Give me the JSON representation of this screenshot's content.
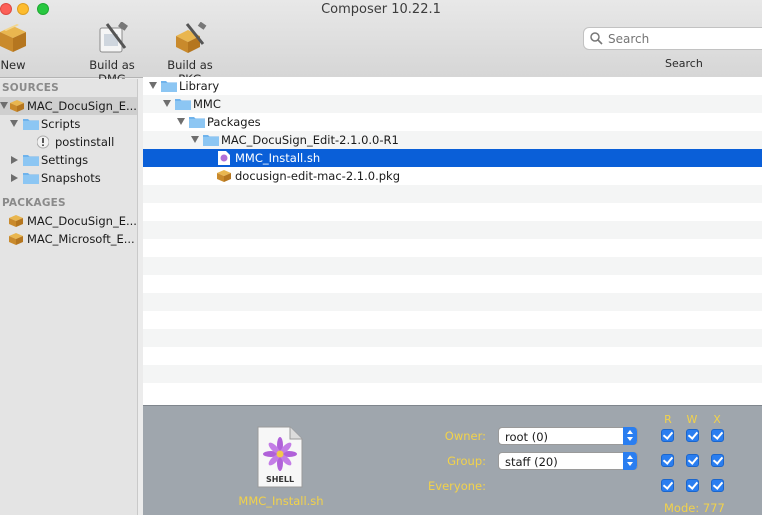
{
  "window": {
    "title": "Composer 10.22.1"
  },
  "toolbar": {
    "new_label": "New",
    "build_dmg_label": "Build as DMG",
    "build_pkg_label": "Build as PKG",
    "search_placeholder": "Search",
    "search_label": "Search"
  },
  "sidebar": {
    "sources_header": "SOURCES",
    "packages_header": "PACKAGES",
    "sources": [
      {
        "label": "MAC_DocuSign_E..."
      },
      {
        "label": "Scripts"
      },
      {
        "label": "postinstall"
      },
      {
        "label": "Settings"
      },
      {
        "label": "Snapshots"
      }
    ],
    "packages": [
      {
        "label": "MAC_DocuSign_E..."
      },
      {
        "label": "MAC_Microsoft_E..."
      }
    ]
  },
  "tree": {
    "rows": [
      {
        "label": "Library"
      },
      {
        "label": "MMC"
      },
      {
        "label": "Packages"
      },
      {
        "label": "MAC_DocuSign_Edit-2.1.0.0-R1"
      },
      {
        "label": "MMC_Install.sh"
      },
      {
        "label": "docusign-edit-mac-2.1.0.pkg"
      }
    ]
  },
  "inspector": {
    "file_name": "MMC_Install.sh",
    "file_icon_text": "SHELL",
    "owner_label": "Owner:",
    "owner_value": "root (0)",
    "group_label": "Group:",
    "group_value": "staff (20)",
    "everyone_label": "Everyone:",
    "col_r": "R",
    "col_w": "W",
    "col_x": "X",
    "mode": "Mode: 777"
  },
  "colors": {
    "selection": "#0a5fd8",
    "inspector_bg": "#9fa6ad",
    "inspector_text": "#f2d24a",
    "checkbox": "#2a7ef0"
  }
}
